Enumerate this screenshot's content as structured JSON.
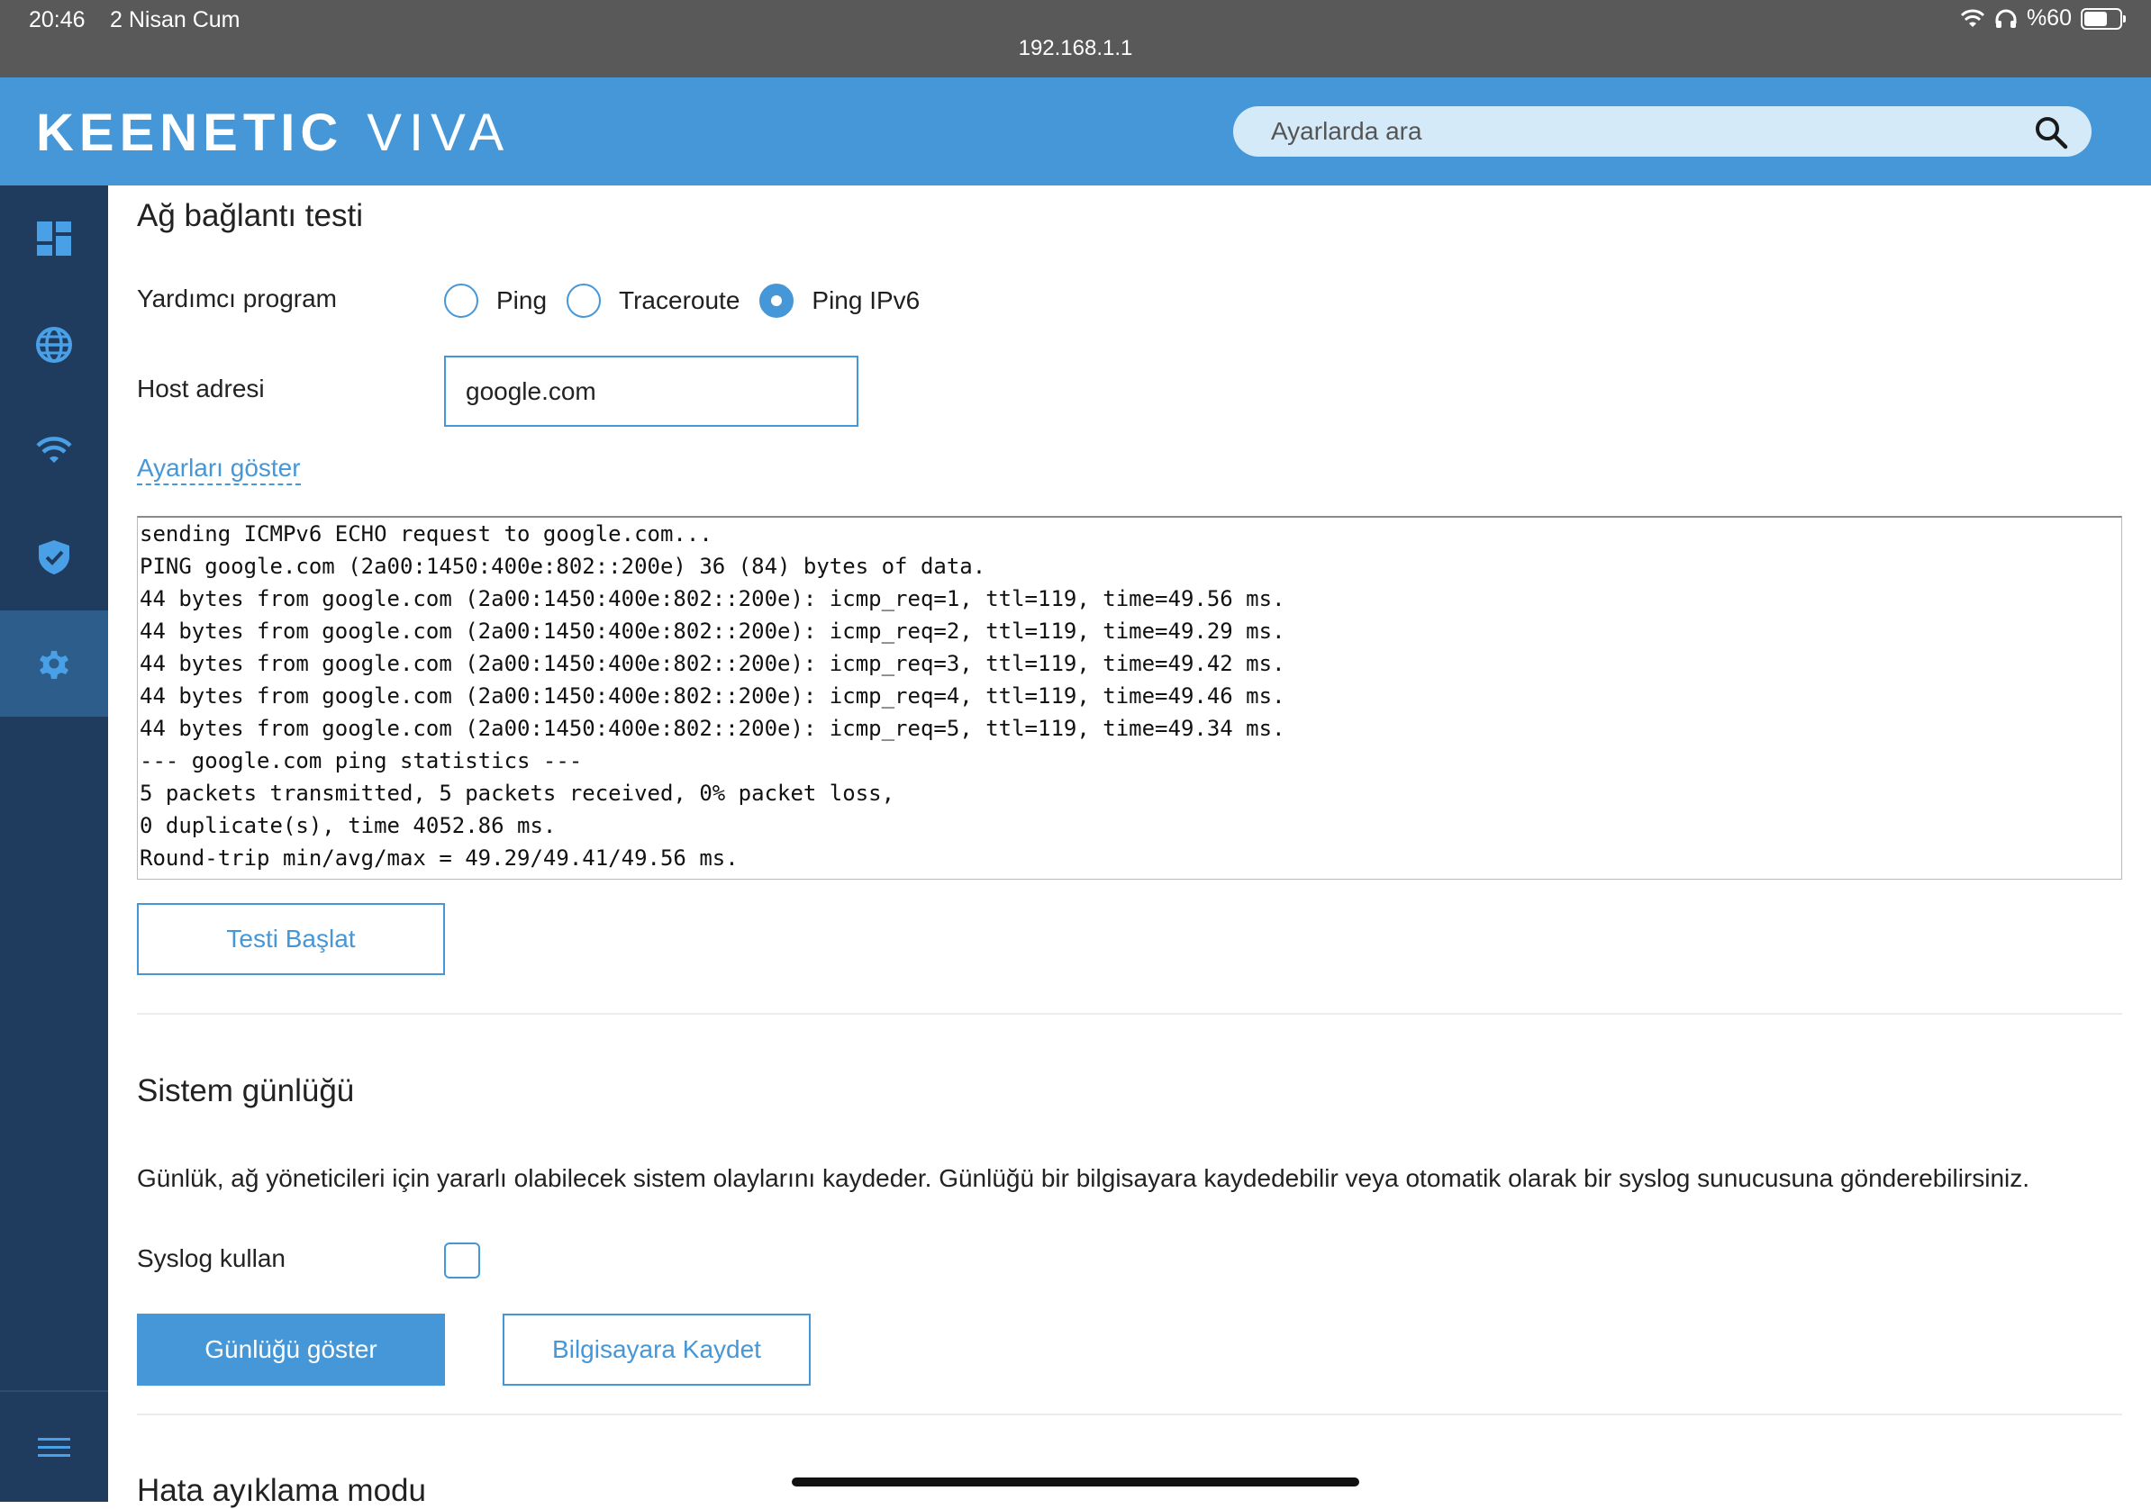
{
  "status_bar": {
    "time": "20:46",
    "date": "2 Nisan Cum",
    "url": "192.168.1.1",
    "battery": "%60"
  },
  "header": {
    "brand": "KEENETIC",
    "model": "VIVA",
    "search_placeholder": "Ayarlarda ara"
  },
  "sidebar": {
    "items": [
      {
        "icon": "dashboard-icon"
      },
      {
        "icon": "globe-icon"
      },
      {
        "icon": "wifi-icon"
      },
      {
        "icon": "shield-icon"
      },
      {
        "icon": "gear-icon",
        "active": true
      }
    ],
    "bottom_icon": "menu-icon"
  },
  "network_test": {
    "title": "Ağ bağlantı testi",
    "utility_label": "Yardımcı program",
    "options": [
      "Ping",
      "Traceroute",
      "Ping IPv6"
    ],
    "selected": "Ping IPv6",
    "host_label": "Host adresi",
    "host_value": "google.com",
    "show_settings": "Ayarları göster",
    "output_lines": [
      "sending ICMPv6 ECHO request to google.com...",
      "PING google.com (2a00:1450:400e:802::200e) 36 (84) bytes of data.",
      "44 bytes from google.com (2a00:1450:400e:802::200e): icmp_req=1, ttl=119, time=49.56 ms.",
      "44 bytes from google.com (2a00:1450:400e:802::200e): icmp_req=2, ttl=119, time=49.29 ms.",
      "44 bytes from google.com (2a00:1450:400e:802::200e): icmp_req=3, ttl=119, time=49.42 ms.",
      "44 bytes from google.com (2a00:1450:400e:802::200e): icmp_req=4, ttl=119, time=49.46 ms.",
      "44 bytes from google.com (2a00:1450:400e:802::200e): icmp_req=5, ttl=119, time=49.34 ms.",
      "--- google.com ping statistics ---",
      "5 packets transmitted, 5 packets received, 0% packet loss,",
      "0 duplicate(s), time 4052.86 ms.",
      "Round-trip min/avg/max = 49.29/49.41/49.56 ms."
    ],
    "start_button": "Testi Başlat"
  },
  "system_log": {
    "title": "Sistem günlüğü",
    "description": "Günlük, ağ yöneticileri için yararlı olabilecek sistem olaylarını kaydeder. Günlüğü bir bilgisayara kaydedebilir veya otomatik olarak bir syslog sunucusuna gönderebilirsiniz.",
    "syslog_label": "Syslog kullan",
    "show_log_button": "Günlüğü göster",
    "save_button": "Bilgisayara Kaydet"
  },
  "debug_mode": {
    "title": "Hata ayıklama modu"
  },
  "colors": {
    "accent": "#4597d8",
    "sidebar": "#1f3b5e",
    "sidebar_active": "#2d5d8a"
  }
}
